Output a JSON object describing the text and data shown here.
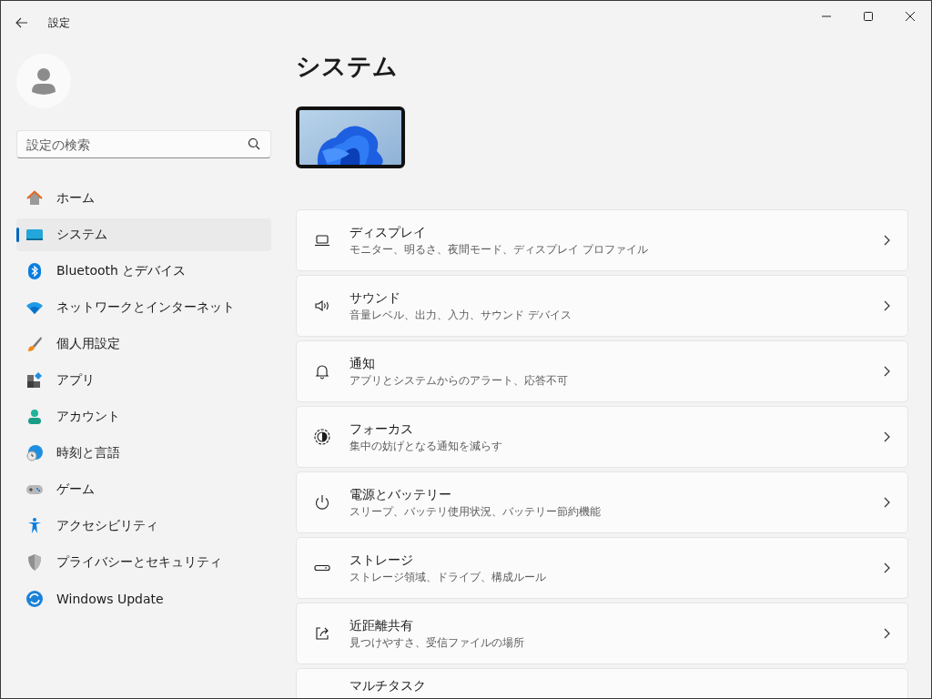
{
  "window": {
    "title": "設定"
  },
  "search": {
    "placeholder": "設定の検索"
  },
  "sidebar": {
    "items": [
      {
        "label": "ホーム",
        "selected": false
      },
      {
        "label": "システム",
        "selected": true
      },
      {
        "label": "Bluetooth とデバイス",
        "selected": false
      },
      {
        "label": "ネットワークとインターネット",
        "selected": false
      },
      {
        "label": "個人用設定",
        "selected": false
      },
      {
        "label": "アプリ",
        "selected": false
      },
      {
        "label": "アカウント",
        "selected": false
      },
      {
        "label": "時刻と言語",
        "selected": false
      },
      {
        "label": "ゲーム",
        "selected": false
      },
      {
        "label": "アクセシビリティ",
        "selected": false
      },
      {
        "label": "プライバシーとセキュリティ",
        "selected": false
      },
      {
        "label": "Windows Update",
        "selected": false
      }
    ]
  },
  "page": {
    "heading": "システム"
  },
  "cards": [
    {
      "title": "ディスプレイ",
      "subtitle": "モニター、明るさ、夜間モード、ディスプレイ プロファイル"
    },
    {
      "title": "サウンド",
      "subtitle": "音量レベル、出力、入力、サウンド デバイス"
    },
    {
      "title": "通知",
      "subtitle": "アプリとシステムからのアラート、応答不可"
    },
    {
      "title": "フォーカス",
      "subtitle": "集中の妨げとなる通知を減らす"
    },
    {
      "title": "電源とバッテリー",
      "subtitle": "スリープ、バッテリ使用状況、バッテリー節約機能"
    },
    {
      "title": "ストレージ",
      "subtitle": "ストレージ領域、ドライブ、構成ルール"
    },
    {
      "title": "近距離共有",
      "subtitle": "見つけやすさ、受信ファイルの場所"
    },
    {
      "title": "マルチタスク"
    }
  ]
}
